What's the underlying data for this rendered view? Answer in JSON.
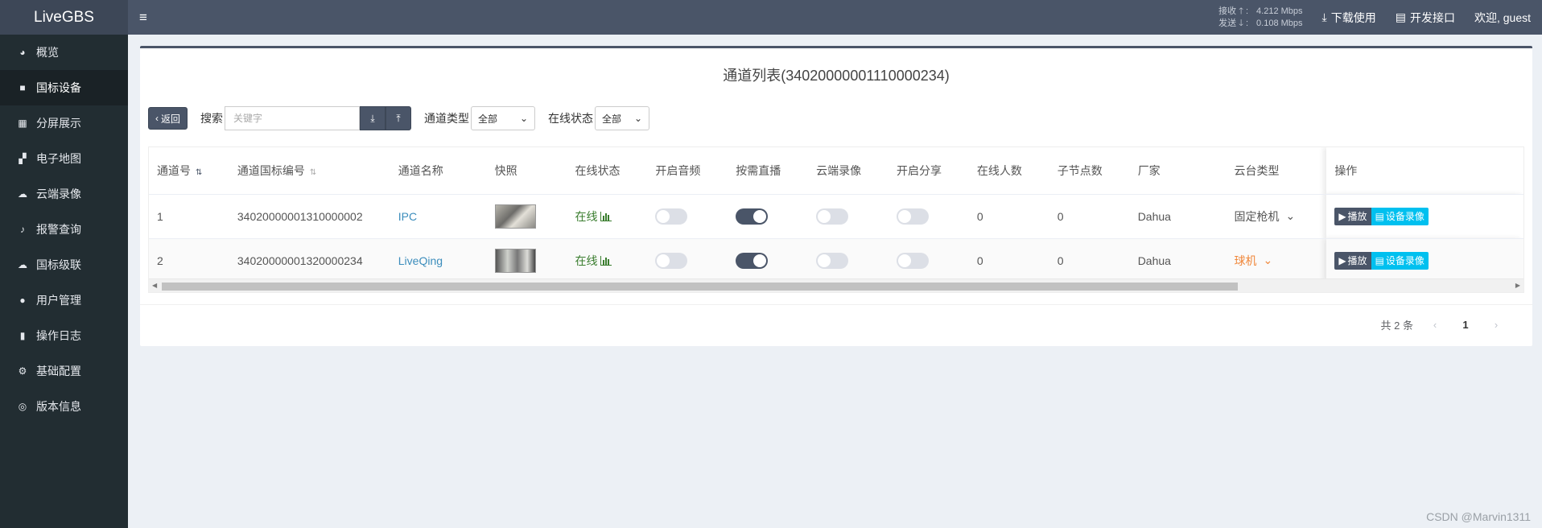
{
  "header": {
    "logo": "LiveGBS",
    "menu_icon": "hamburger-icon",
    "rate": {
      "recv_label": "接收",
      "recv_value": "4.212 Mbps",
      "send_label": "发送",
      "send_value": "0.108 Mbps"
    },
    "download_label": "下载使用",
    "api_label": "开发接口",
    "welcome": "欢迎, guest"
  },
  "sidebar": {
    "items": [
      {
        "label": "概览",
        "icon": "dashboard-icon"
      },
      {
        "label": "国标设备",
        "icon": "video-camera-icon",
        "active": true
      },
      {
        "label": "分屏展示",
        "icon": "grid-icon"
      },
      {
        "label": "电子地图",
        "icon": "map-icon"
      },
      {
        "label": "云端录像",
        "icon": "cloud-icon"
      },
      {
        "label": "报警查询",
        "icon": "bell-icon"
      },
      {
        "label": "国标级联",
        "icon": "cloud-upload-icon"
      },
      {
        "label": "用户管理",
        "icon": "users-icon"
      },
      {
        "label": "操作日志",
        "icon": "file-icon"
      },
      {
        "label": "基础配置",
        "icon": "gears-icon"
      },
      {
        "label": "版本信息",
        "icon": "life-ring-icon"
      }
    ]
  },
  "main": {
    "title": "通道列表(34020000001110000234)",
    "toolbar": {
      "back_label": "返回",
      "search_label": "搜索",
      "search_placeholder": "关键字",
      "channel_type_label": "通道类型",
      "channel_type_value": "全部",
      "online_status_label": "在线状态",
      "online_status_value": "全部"
    },
    "table": {
      "columns": [
        "通道号",
        "通道国标编号",
        "通道名称",
        "快照",
        "在线状态",
        "开启音频",
        "按需直播",
        "云端录像",
        "开启分享",
        "在线人数",
        "子节点数",
        "厂家",
        "云台类型",
        "操作"
      ],
      "rows": [
        {
          "no": "1",
          "code": "34020000001310000002",
          "name": "IPC",
          "status": "在线",
          "audio": false,
          "ondemand": true,
          "cloud": false,
          "share": false,
          "online_count": "0",
          "children": "0",
          "vendor": "Dahua",
          "ptz": "固定枪机",
          "ptz_color": "#555555"
        },
        {
          "no": "2",
          "code": "34020000001320000234",
          "name": "LiveQing",
          "status": "在线",
          "audio": false,
          "ondemand": true,
          "cloud": false,
          "share": false,
          "online_count": "0",
          "children": "0",
          "vendor": "Dahua",
          "ptz": "球机",
          "ptz_color": "#f0873a"
        }
      ],
      "play_label": "播放",
      "record_label": "设备录像"
    },
    "pager": {
      "total": "共 2 条",
      "current_page": "1"
    }
  },
  "watermark": "CSDN @Marvin1311"
}
